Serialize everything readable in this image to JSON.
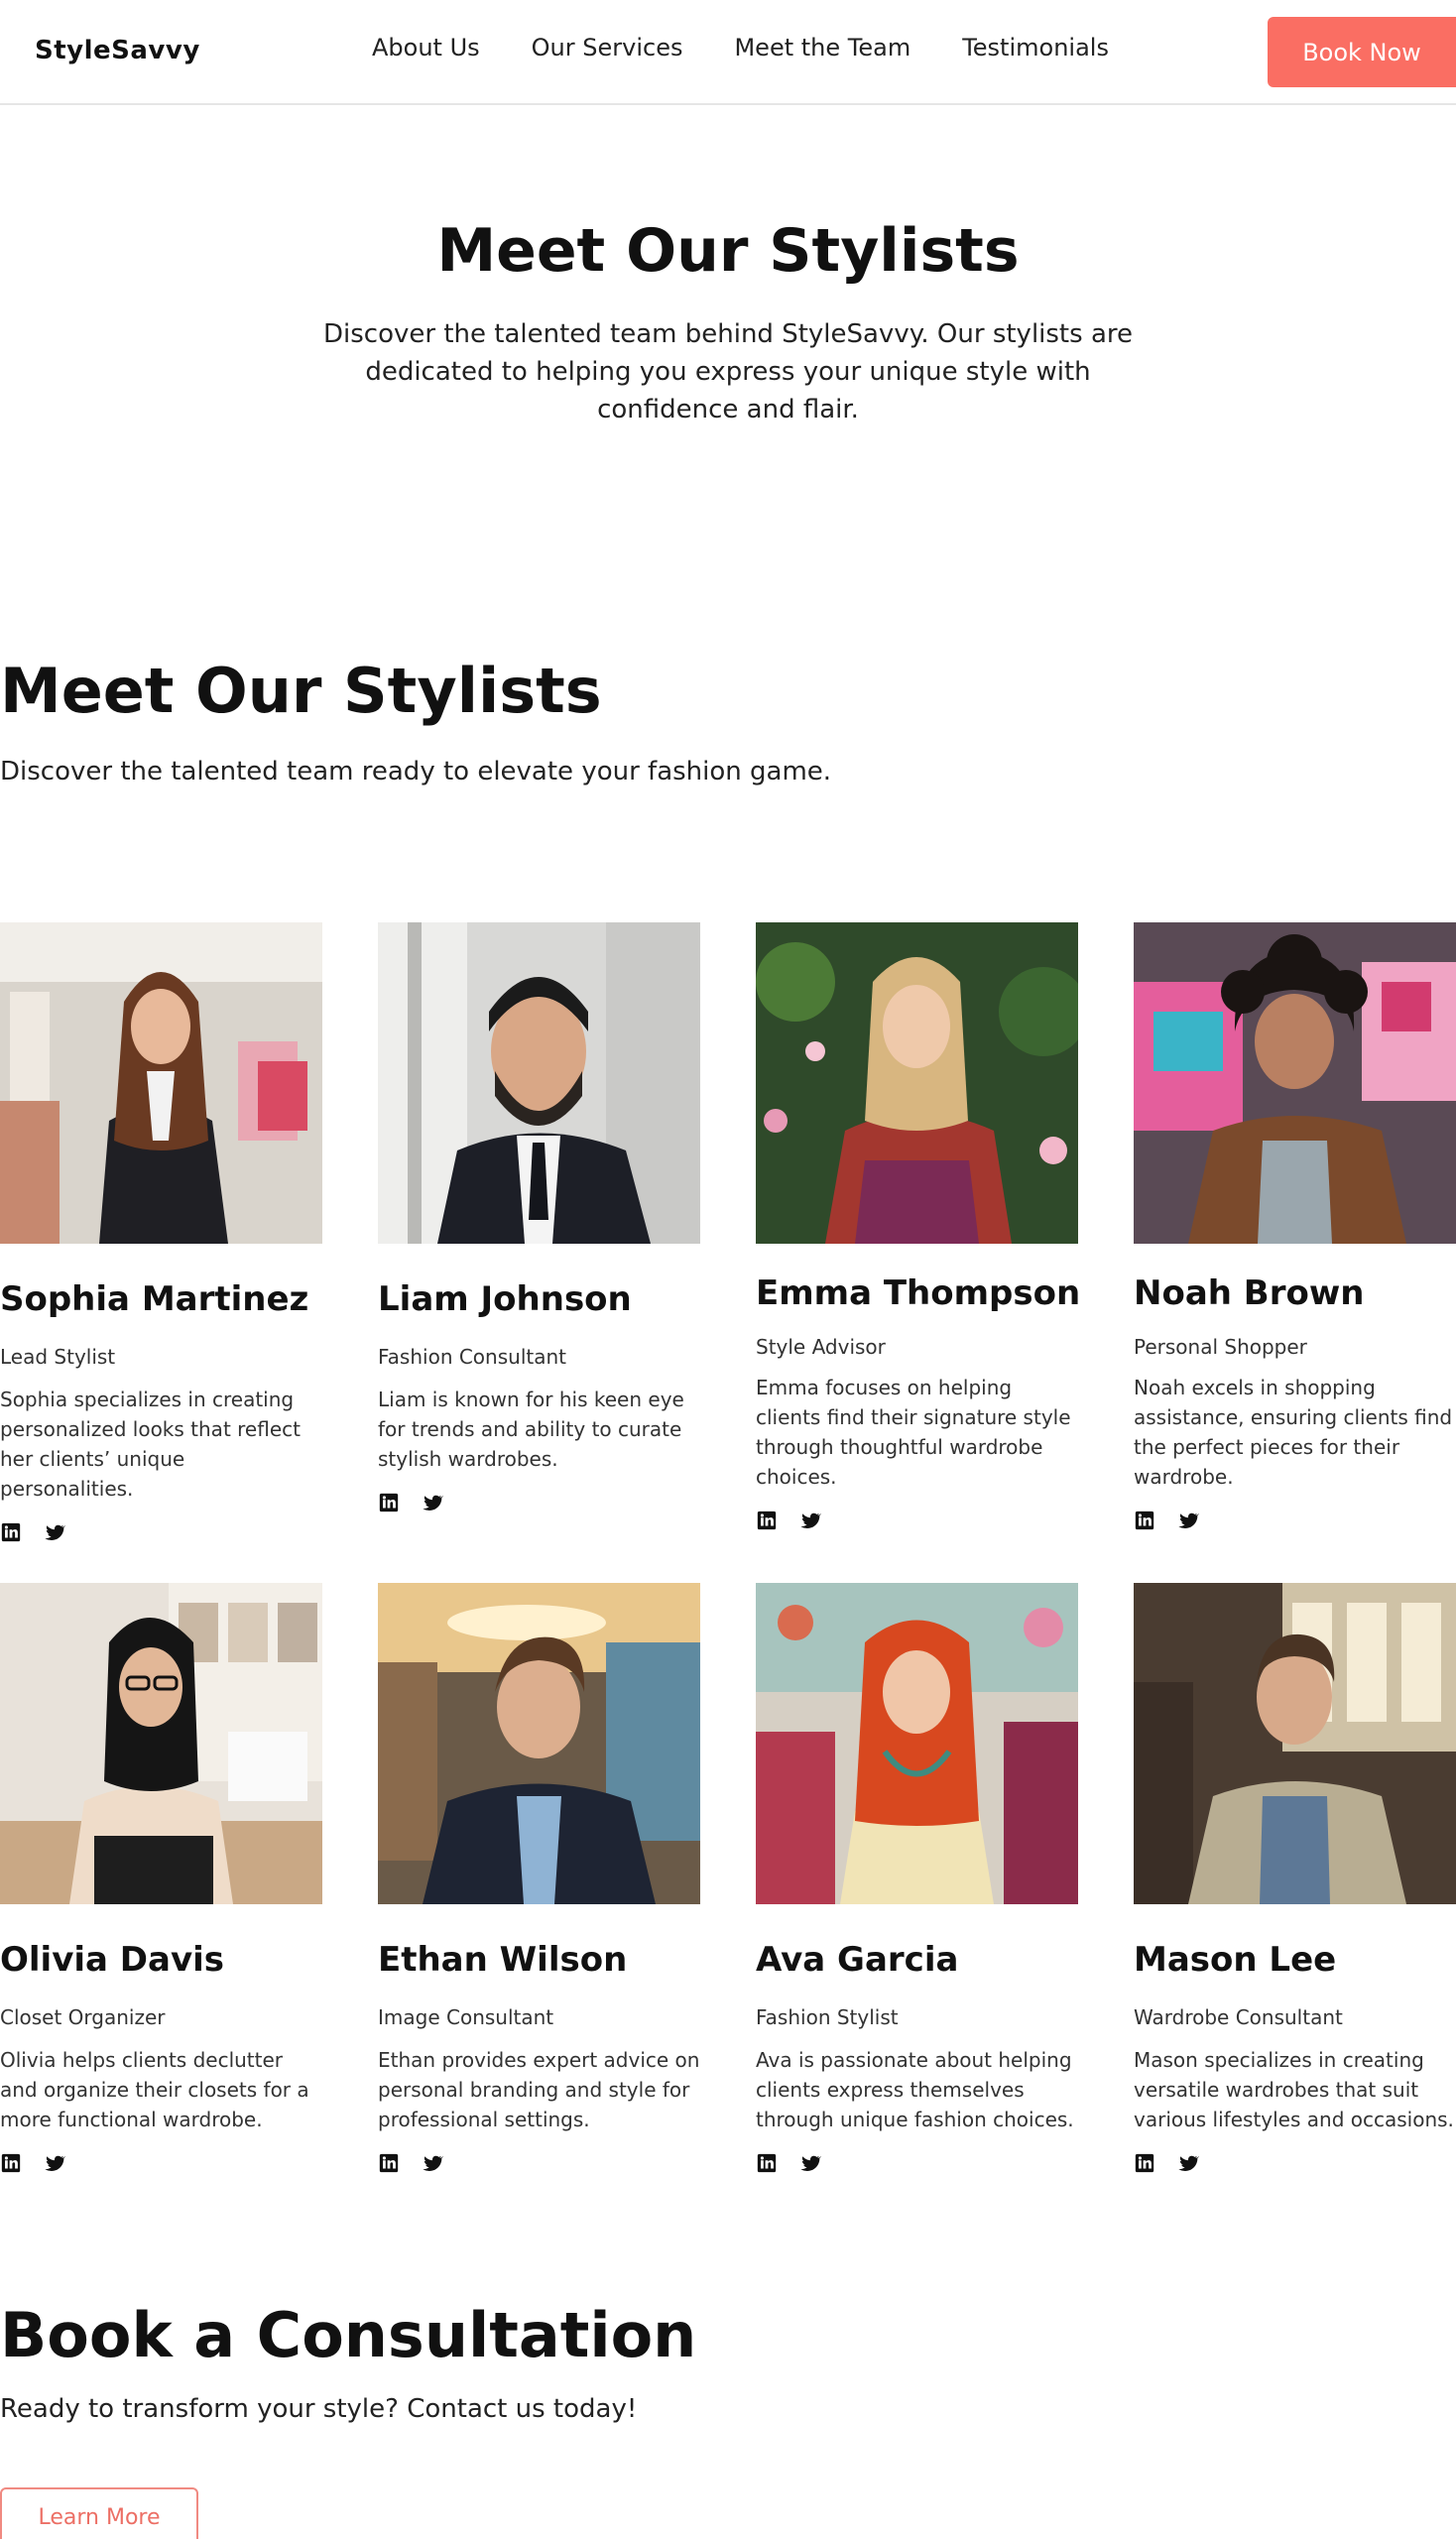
{
  "header": {
    "logo": "StyleSavvy",
    "nav": [
      "About Us",
      "Our Services",
      "Meet the Team",
      "Testimonials"
    ],
    "book_label": "Book Now",
    "accent_color": "#fa6e63"
  },
  "hero": {
    "title": "Meet Our Stylists",
    "description": "Discover the talented team behind StyleSavvy. Our stylists are dedicated to helping you express your unique style with confidence and flair."
  },
  "team_section": {
    "title": "Meet Our Stylists",
    "description": "Discover the talented team ready to elevate your fashion game."
  },
  "stylists": [
    {
      "name": "Sophia Martinez",
      "role": "Lead Stylist",
      "bio": "Sophia specializes in creating personalized looks that reflect her clients’ unique personalities."
    },
    {
      "name": "Liam Johnson",
      "role": "Fashion Consultant",
      "bio": "Liam is known for his keen eye for trends and ability to curate stylish wardrobes."
    },
    {
      "name": "Emma Thompson",
      "role": "Style Advisor",
      "bio": "Emma focuses on helping clients find their signature style through thoughtful wardrobe choices."
    },
    {
      "name": "Noah Brown",
      "role": "Personal Shopper",
      "bio": "Noah excels in shopping assistance, ensuring clients find the perfect pieces for their wardrobe."
    },
    {
      "name": "Olivia Davis",
      "role": "Closet Organizer",
      "bio": "Olivia helps clients declutter and organize their closets for a more functional wardrobe."
    },
    {
      "name": "Ethan Wilson",
      "role": "Image Consultant",
      "bio": "Ethan provides expert advice on personal branding and style for professional settings."
    },
    {
      "name": "Ava Garcia",
      "role": "Fashion Stylist",
      "bio": "Ava is passionate about helping clients express themselves through unique fashion choices."
    },
    {
      "name": "Mason Lee",
      "role": "Wardrobe Consultant",
      "bio": "Mason specializes in creating versatile wardrobes that suit various lifestyles and occasions."
    }
  ],
  "social_icons": [
    "linkedin-icon",
    "twitter-icon"
  ],
  "book_section": {
    "title": "Book a Consultation",
    "description": "Ready to transform your style? Contact us today!",
    "button_label": "Learn More"
  }
}
